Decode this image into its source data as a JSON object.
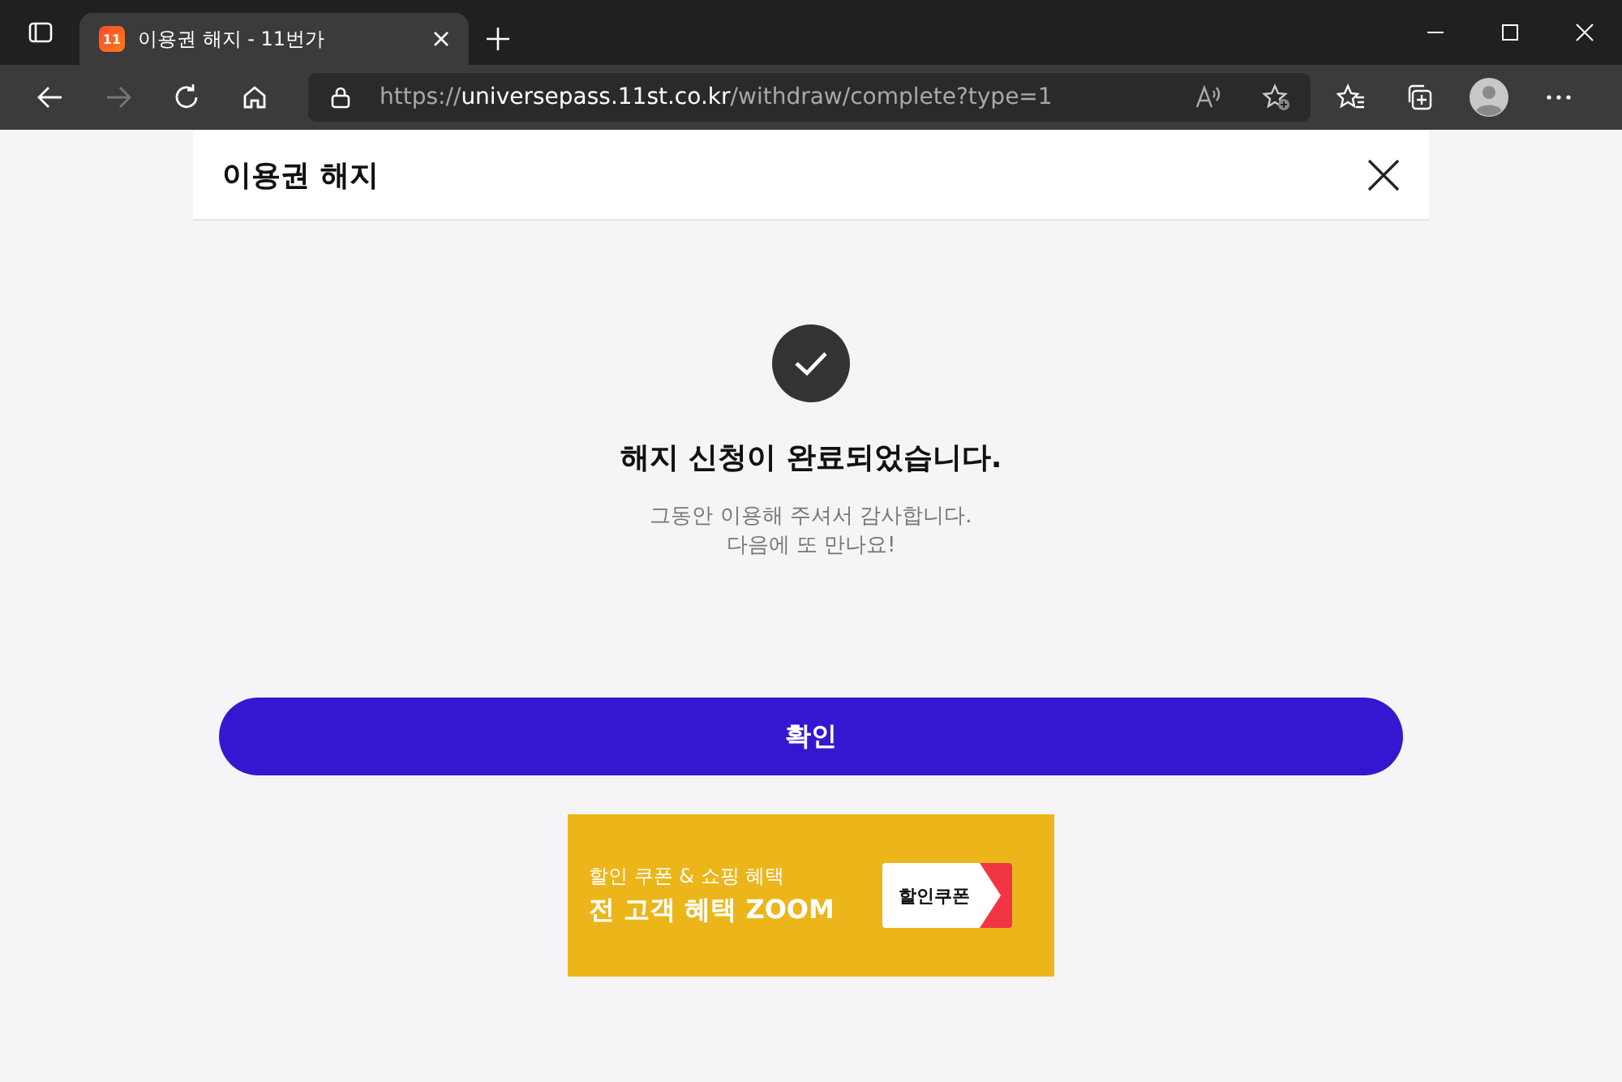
{
  "browser": {
    "tab": {
      "favicon": "11",
      "title": "이용권 해지 - 11번가",
      "selected": true
    },
    "address": {
      "scheme": "https://",
      "host": "universepass.11st.co.kr",
      "path": "/withdraw/complete?type=1"
    }
  },
  "header": {
    "title": "이용권 해지"
  },
  "result": {
    "title": "해지 신청이 완료되었습니다.",
    "lines": [
      "그동안 이용해 주셔서 감사합니다.",
      "다음에 또 만나요!"
    ]
  },
  "confirm_button": "확인",
  "banner": {
    "subtitle": "할인 쿠폰 & 쇼핑 혜택",
    "title": "전 고객 혜택 ZOOM",
    "coupon": "할인쿠폰"
  }
}
